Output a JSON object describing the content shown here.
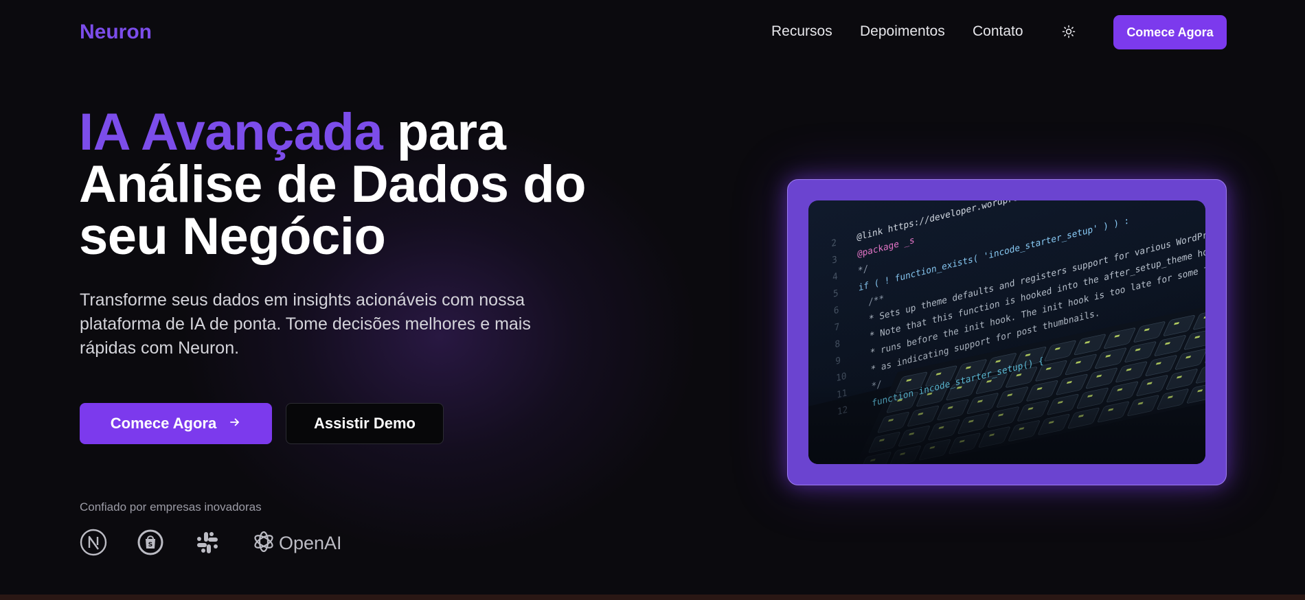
{
  "brand": {
    "name": "Neuron"
  },
  "nav": {
    "links": [
      "Recursos",
      "Depoimentos",
      "Contato"
    ],
    "theme_icon": "sun-icon",
    "cta": "Comece Agora"
  },
  "hero": {
    "title_accent": "IA Avançada",
    "title_rest_line1": " para",
    "title_line2": "Análise de Dados do",
    "title_line3": "seu Negócio",
    "subtitle": "Transforme seus dados em insights acionáveis com nossa plataforma de IA de ponta. Tome decisões melhores e mais rápidas com Neuron.",
    "primary_button": "Comece Agora",
    "primary_button_icon": "arrow-right-icon",
    "secondary_button": "Assistir Demo"
  },
  "trust": {
    "label": "Confiado por empresas inovadoras",
    "logos": [
      "nextjs-logo",
      "shopify-logo",
      "slack-logo",
      "openai-logo"
    ],
    "openai_text": "OpenAI"
  },
  "image": {
    "description_icon": "code-on-laptop-photo",
    "code_lines": [
      "@link https://developer.wordpress.org/",
      "@package _s",
      "*/",
      "if ( ! function_exists( 'incode_starter_setup' ) ) :",
      "/**",
      " * Sets up theme defaults and registers support for various WordPress features.",
      " * Note that this function is hooked into the after_setup_theme hook, which",
      " * runs before the init hook. The init hook is too late for some features, such",
      " * as indicating support for post thumbnails.",
      " */",
      "function incode_starter_setup() {"
    ]
  },
  "colors": {
    "accent": "#7c3aed",
    "accent_text": "#7c4dea",
    "background": "#0b0a0e"
  }
}
